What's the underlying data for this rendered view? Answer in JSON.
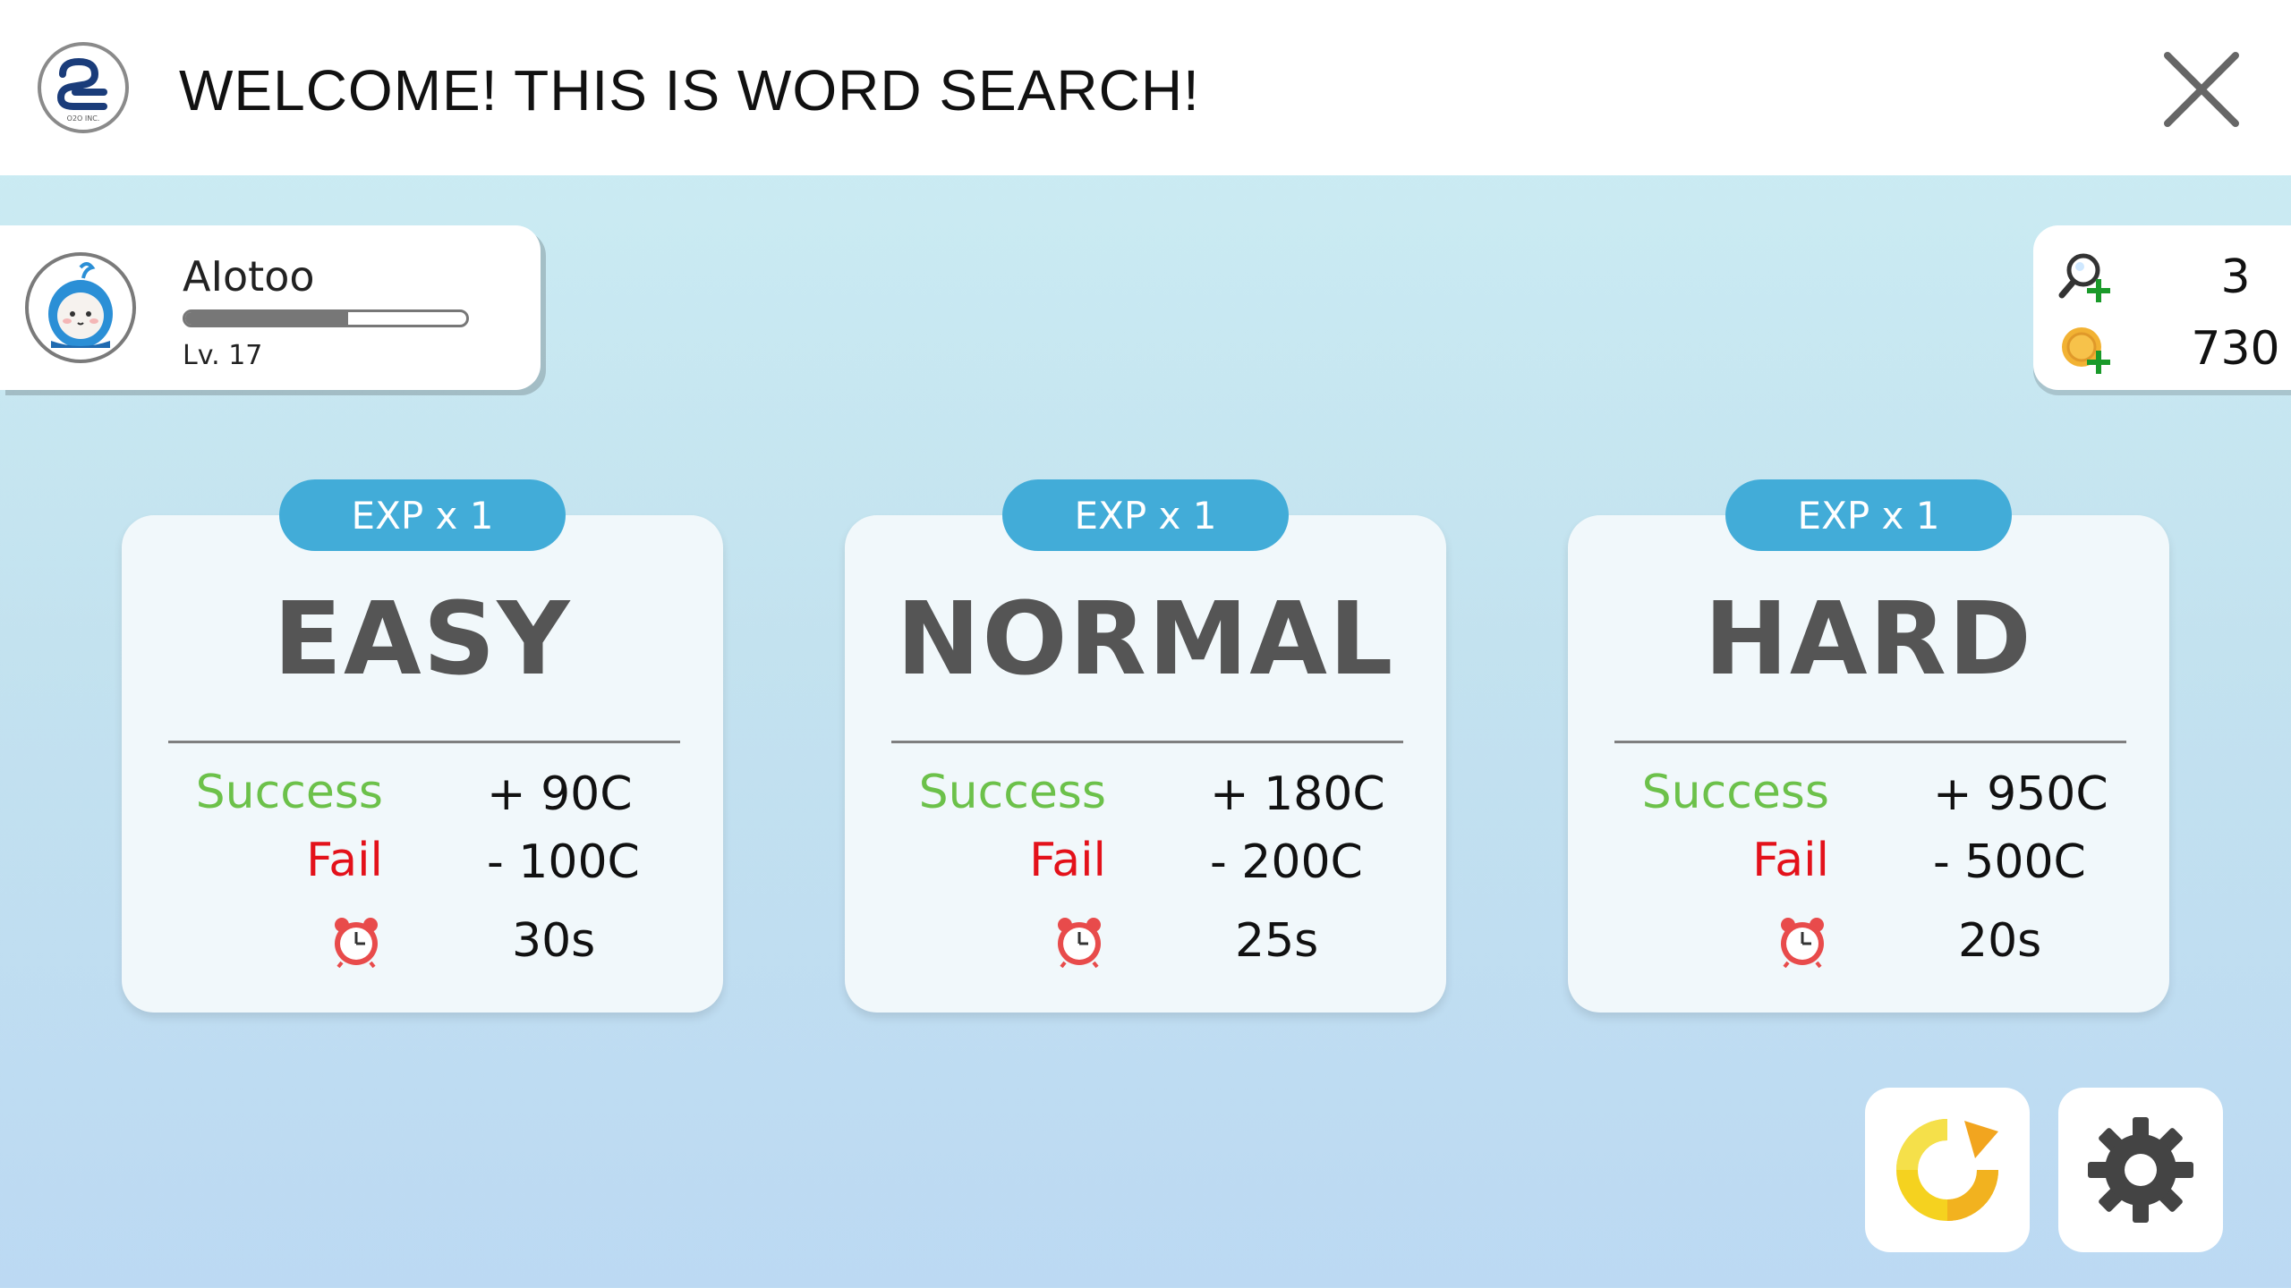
{
  "header": {
    "title": "WELCOME! THIS IS WORD SEARCH!",
    "logo_icon": "company-logo-icon",
    "logo_text": "O2O INC.",
    "close_icon": "close-icon"
  },
  "profile": {
    "username": "AIotoo",
    "level": "Lv. 17",
    "xp_progress_fraction": 0.58,
    "avatar_icon": "mascot-avatar-icon"
  },
  "resources": {
    "hints": "3",
    "coins": "730",
    "hint_icon": "magnifier-plus-icon",
    "coin_icon": "coin-plus-icon"
  },
  "modes": [
    {
      "exp": "EXP x 1",
      "name": "EASY",
      "success_label": "Success",
      "success_value": "+ 90C",
      "fail_label": "Fail",
      "fail_value": "- 100C",
      "time": "30s"
    },
    {
      "exp": "EXP x 1",
      "name": "NORMAL",
      "success_label": "Success",
      "success_value": "+ 180C",
      "fail_label": "Fail",
      "fail_value": "- 200C",
      "time": "25s"
    },
    {
      "exp": "EXP x 1",
      "name": "HARD",
      "success_label": "Success",
      "success_value": "+ 950C",
      "fail_label": "Fail",
      "fail_value": "- 500C",
      "time": "20s"
    }
  ],
  "buttons": {
    "refresh_icon": "refresh-icon",
    "settings_icon": "gear-icon"
  },
  "colors": {
    "success": "#6cc14a",
    "fail": "#e3111a",
    "exp_pill": "#42acd8",
    "title": "#555555"
  }
}
